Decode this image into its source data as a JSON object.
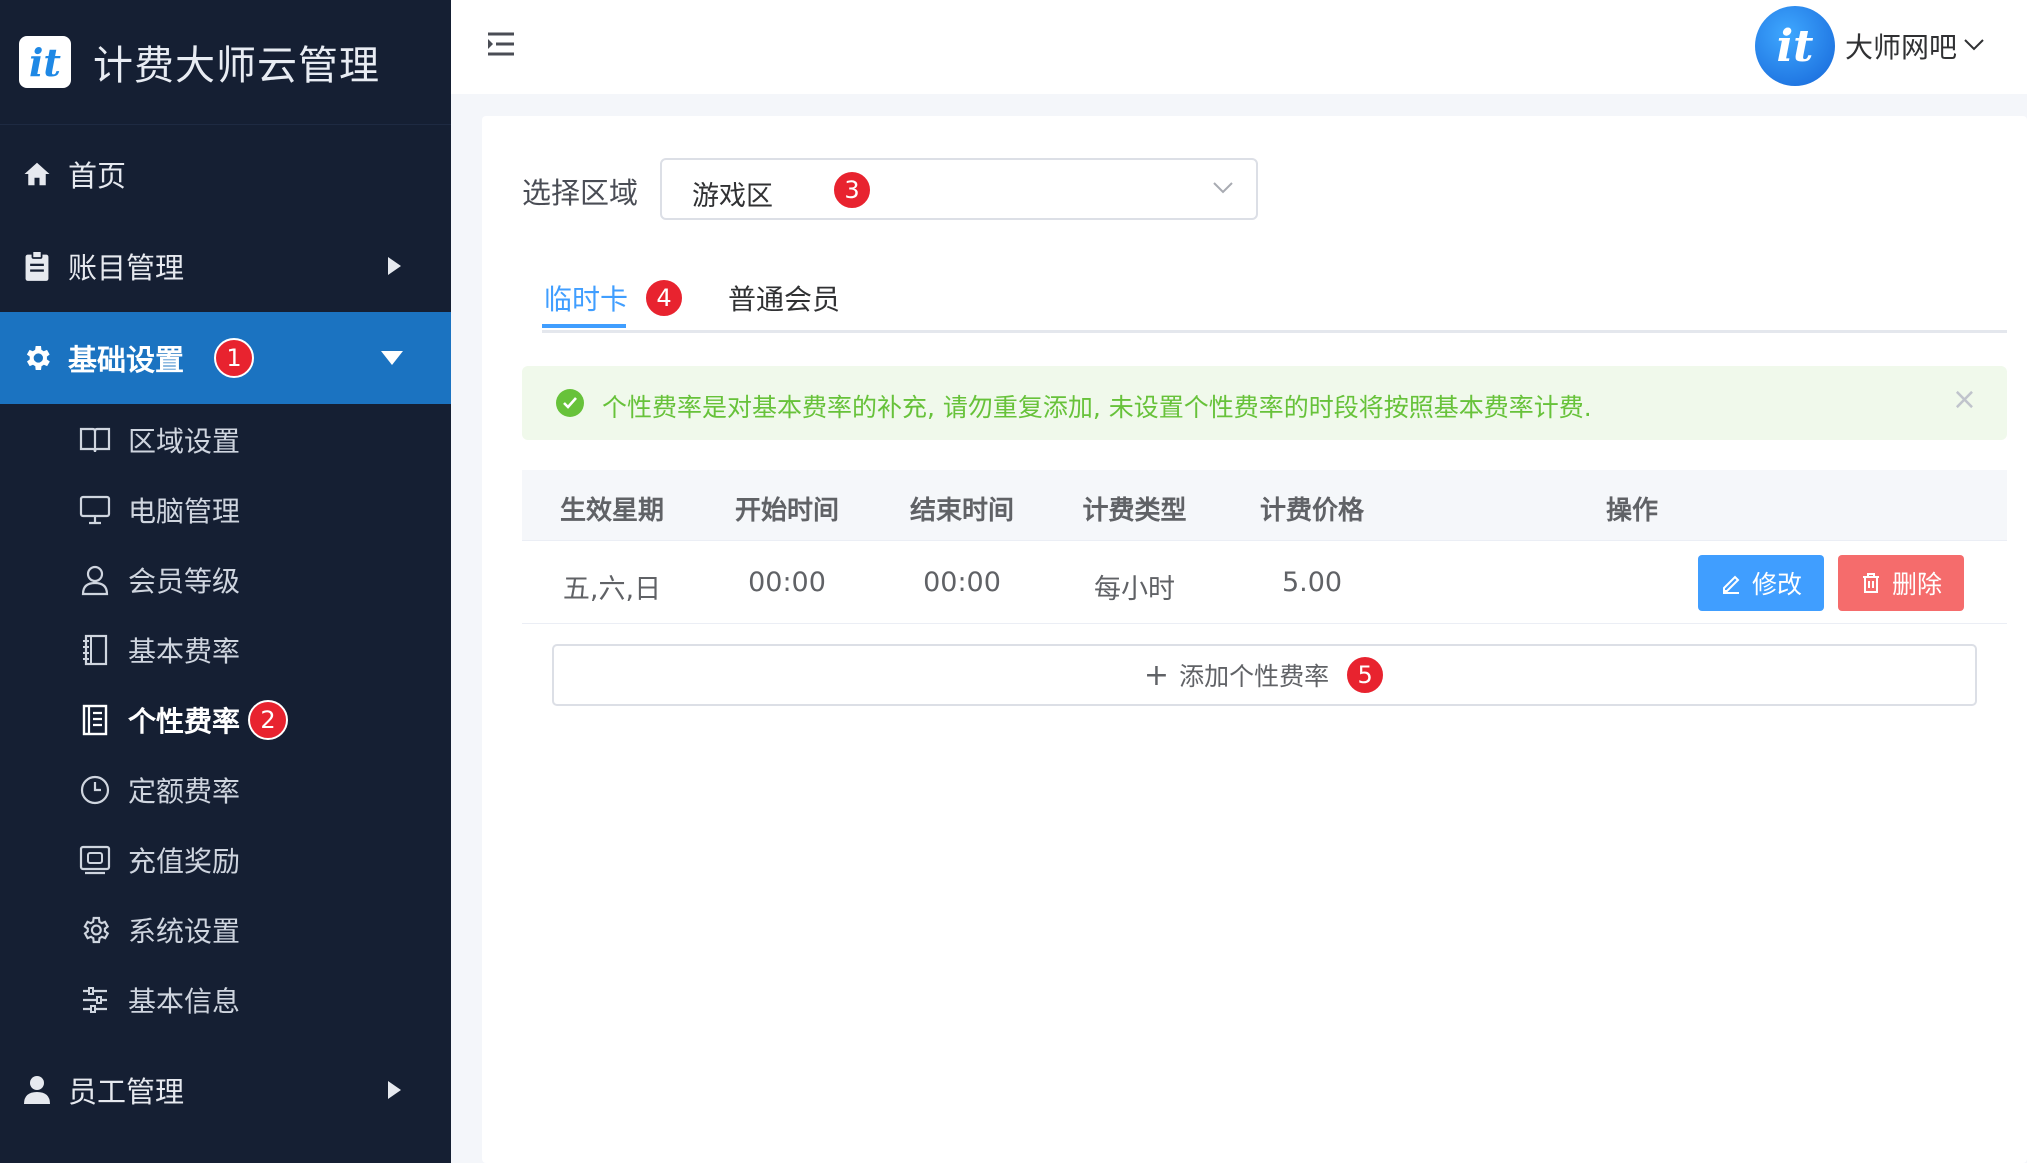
{
  "app": {
    "title": "计费大师云管理",
    "logo_text": "it"
  },
  "sidebar": {
    "items": [
      {
        "label": "首页",
        "icon": "home-icon"
      },
      {
        "label": "账目管理",
        "icon": "clipboard-icon"
      },
      {
        "label": "基础设置",
        "icon": "gear-icon",
        "badge": "1"
      },
      {
        "label": "员工管理",
        "icon": "user-icon"
      }
    ],
    "sub_items": [
      {
        "label": "区域设置",
        "icon": "book-icon"
      },
      {
        "label": "电脑管理",
        "icon": "monitor-icon"
      },
      {
        "label": "会员等级",
        "icon": "person-icon"
      },
      {
        "label": "基本费率",
        "icon": "notebook-icon"
      },
      {
        "label": "个性费率",
        "icon": "document-icon",
        "badge": "2"
      },
      {
        "label": "定额费率",
        "icon": "clock-icon"
      },
      {
        "label": "充值奖励",
        "icon": "wallet-icon"
      },
      {
        "label": "系统设置",
        "icon": "cog-icon"
      },
      {
        "label": "基本信息",
        "icon": "sliders-icon"
      }
    ]
  },
  "header": {
    "user_name": "大师网吧",
    "avatar_text": "it"
  },
  "main": {
    "area_label": "选择区域",
    "area_value": "游戏区",
    "area_badge": "3",
    "tabs": [
      {
        "label": "临时卡",
        "badge": "4"
      },
      {
        "label": "普通会员"
      }
    ],
    "alert_text": "个性费率是对基本费率的补充, 请勿重复添加, 未设置个性费率的时段将按照基本费率计费.",
    "table": {
      "headers": [
        "生效星期",
        "开始时间",
        "结束时间",
        "计费类型",
        "计费价格",
        "操作"
      ],
      "rows": [
        {
          "days": "五,六,日",
          "start": "00:00",
          "end": "00:00",
          "type": "每小时",
          "price": "5.00"
        }
      ],
      "edit_label": "修改",
      "delete_label": "删除"
    },
    "add_label": "添加个性费率",
    "add_badge": "5"
  },
  "colors": {
    "sidebar_bg": "#151f33",
    "active_menu": "#1b73c1",
    "primary": "#409eff",
    "danger": "#f56c6c",
    "success": "#67c23a",
    "badge": "#e8232f"
  }
}
